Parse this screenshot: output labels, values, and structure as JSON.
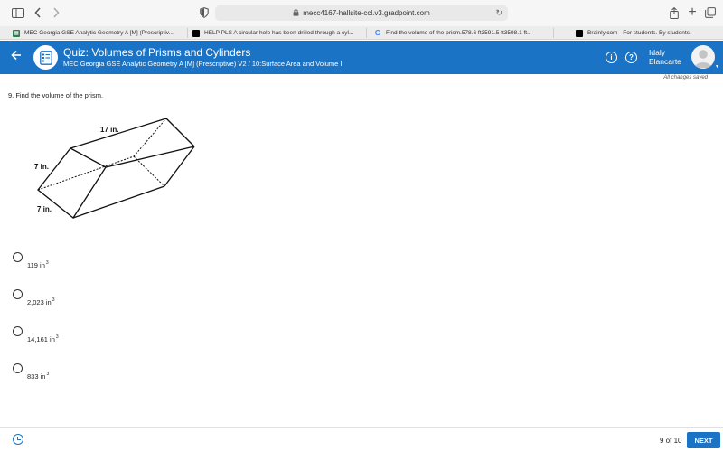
{
  "browser": {
    "url": "mecc4167-hallsite-ccl.v3.gradpoint.com",
    "tabs": [
      {
        "label": "MEC Georgia GSE Analytic Geometry A [M] (Prescriptiv..."
      },
      {
        "label": "HELP PLS A circular hole has been drilled through a cyl..."
      },
      {
        "label": "Find the volume of the prism.578.6 ft3591.5 ft3598.1 ft..."
      },
      {
        "label": "Brainly.com - For students. By students."
      }
    ]
  },
  "header": {
    "title": "Quiz: Volumes of Prisms and Cylinders",
    "subtitle": "MEC Georgia GSE Analytic Geometry A [M] (Prescriptive) V2 / 10:Surface Area and Volume II",
    "info_symbol": "i",
    "help_symbol": "?",
    "user_first": "Idaly",
    "user_last": "Blancarte",
    "accent": "#1a73c5"
  },
  "status": {
    "saved": "All changes saved"
  },
  "question": {
    "text": "9. Find the volume of the prism.",
    "figure_labels": {
      "length": "17 in.",
      "height": "7 in.",
      "width": "7 in."
    },
    "choices": [
      {
        "value": "119 in",
        "exp": "3"
      },
      {
        "value": "2,023 in",
        "exp": "3"
      },
      {
        "value": "14,161 in",
        "exp": "3"
      },
      {
        "value": "833 in",
        "exp": "3"
      }
    ]
  },
  "footer": {
    "progress": "9 of 10",
    "next_label": "NEXT"
  }
}
